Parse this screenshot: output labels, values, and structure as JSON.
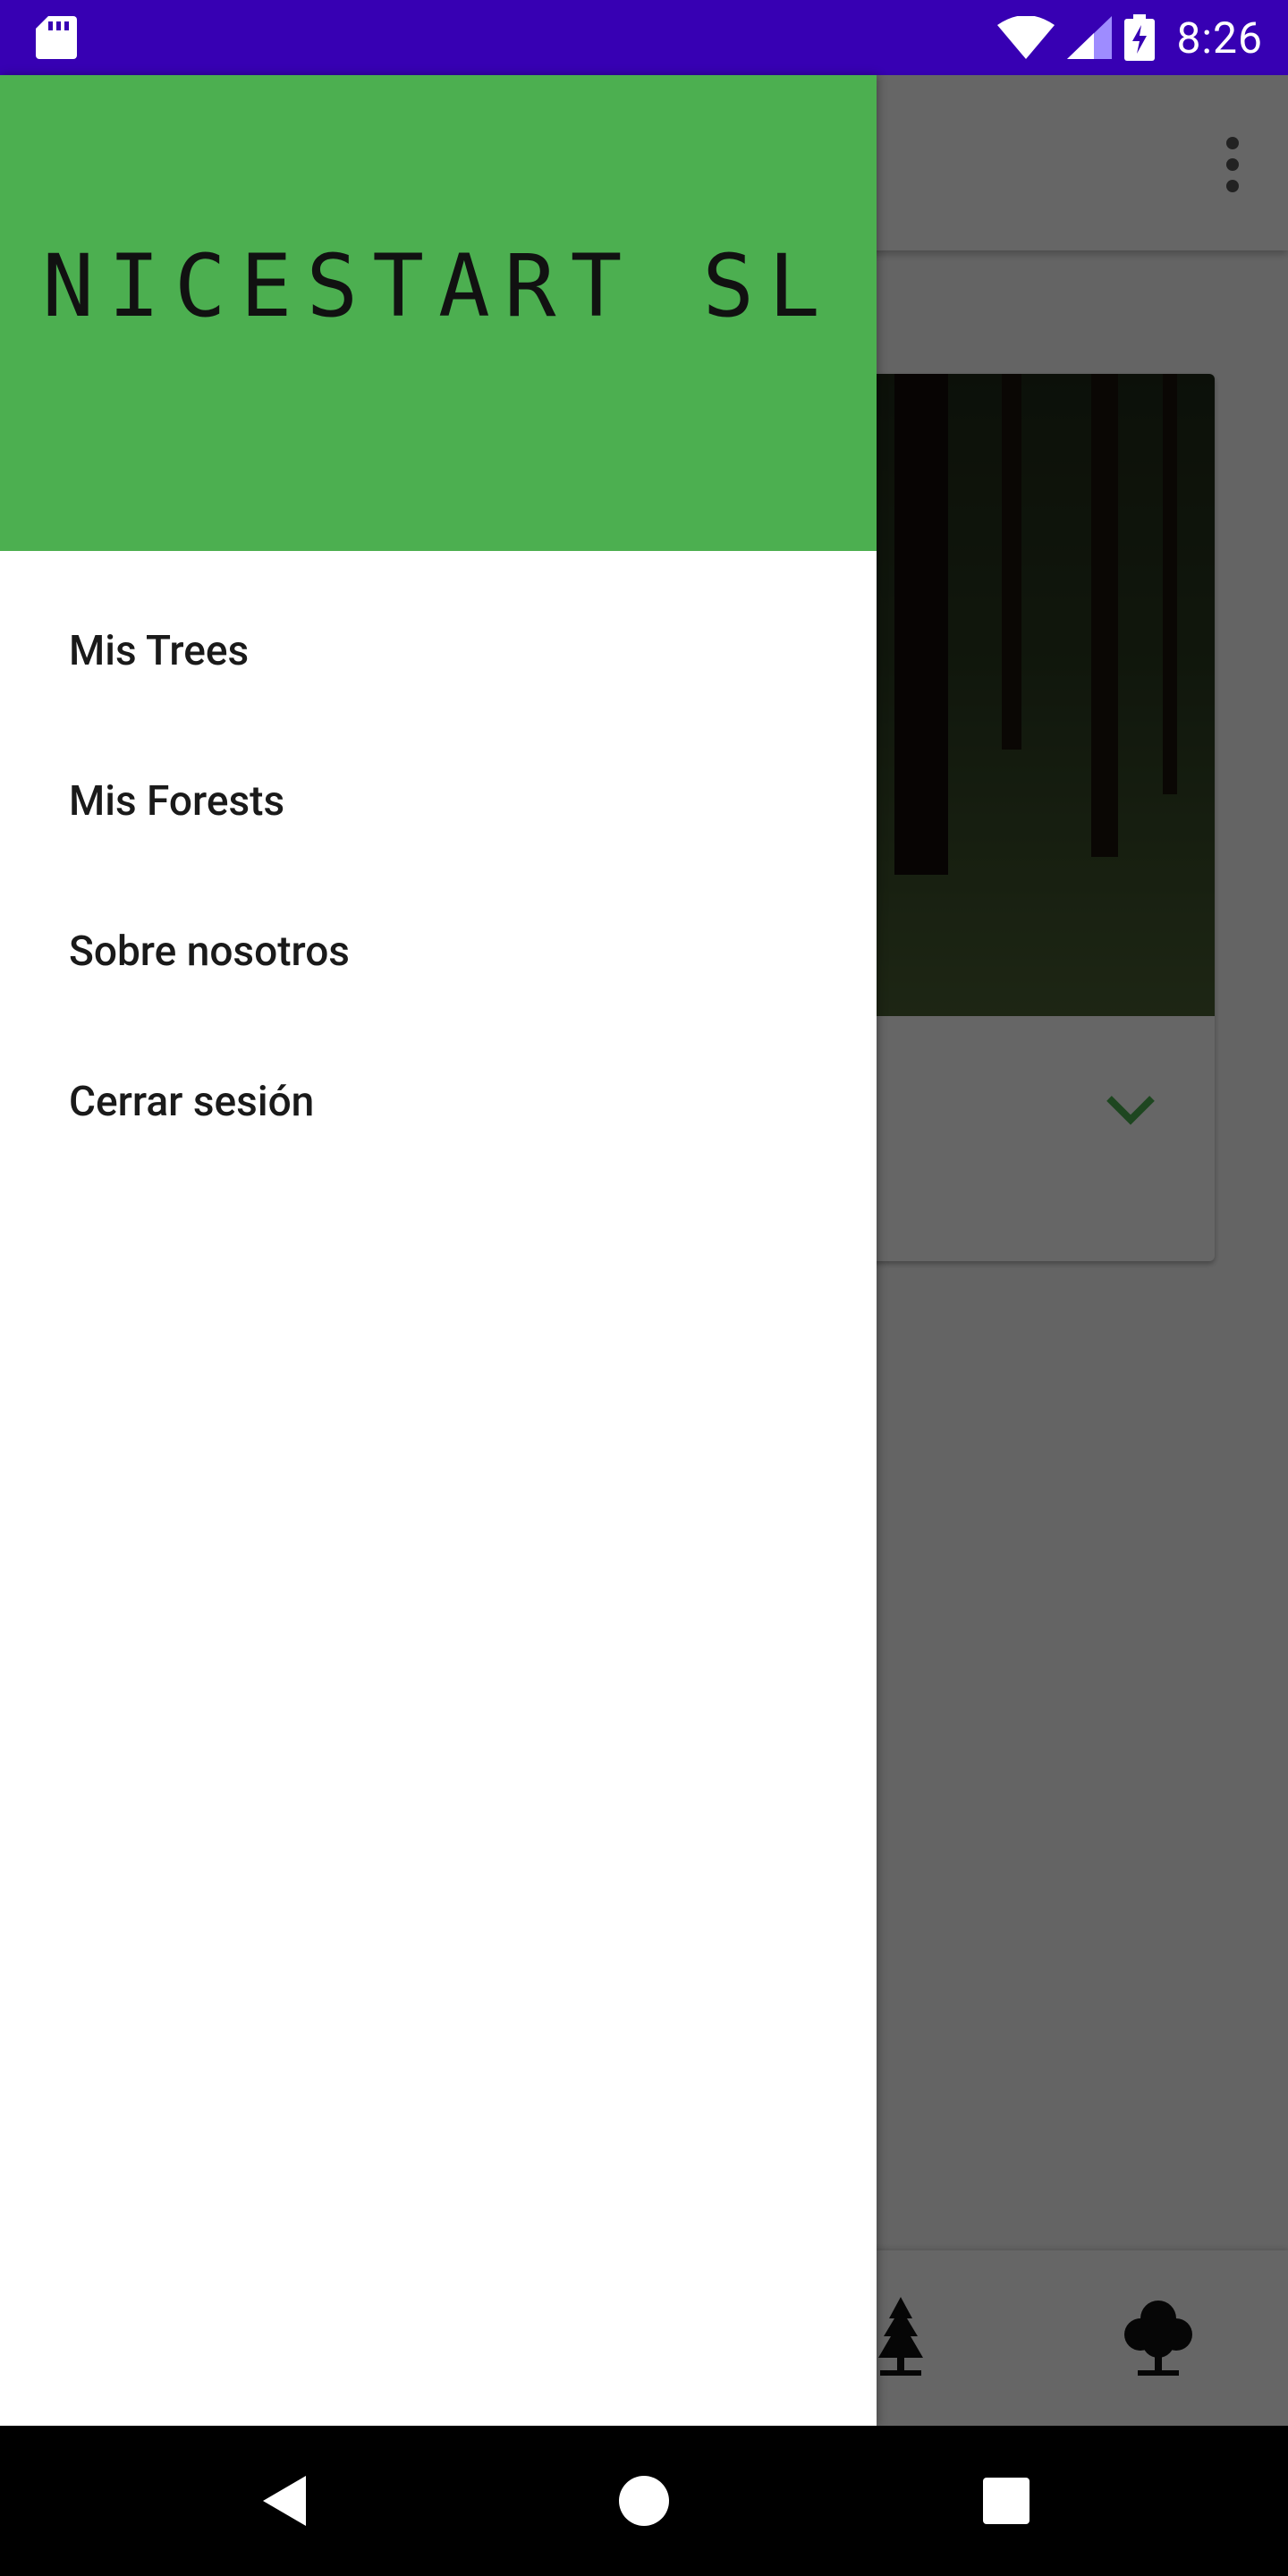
{
  "status_bar": {
    "time": "8:26",
    "icons": [
      "sd-card-icon",
      "wifi-icon",
      "signal-icon",
      "battery-charging-icon"
    ]
  },
  "toolbar": {
    "overflow_icon": "more-vert-icon"
  },
  "card": {
    "expand_icon": "chevron-down-icon"
  },
  "bottom_nav": {
    "items": [
      {
        "icon": "pine-tree-icon"
      },
      {
        "icon": "deciduous-tree-icon"
      }
    ]
  },
  "drawer": {
    "header_title": "NICESTART SL",
    "menu": [
      {
        "label": "Mis Trees"
      },
      {
        "label": "Mis Forests"
      },
      {
        "label": "Sobre nosotros"
      },
      {
        "label": "Cerrar sesión"
      }
    ]
  },
  "system_nav": {
    "back": "back-icon",
    "home": "home-icon",
    "recents": "recents-icon"
  },
  "colors": {
    "status_bar": "#3700b3",
    "drawer_header": "#4caf50",
    "accent": "#4caf50",
    "scrim": "rgba(0,0,0,0.6)"
  }
}
